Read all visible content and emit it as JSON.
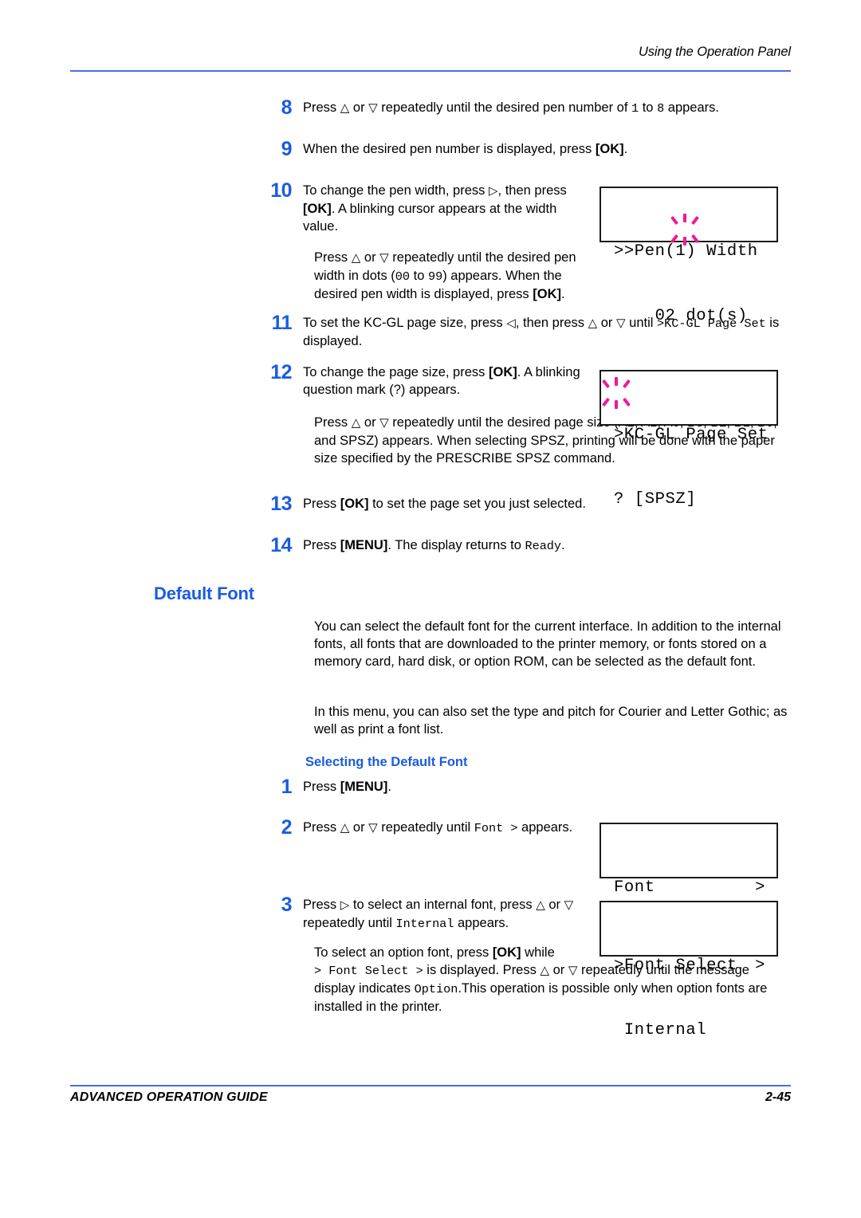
{
  "header": {
    "running_title": "Using the Operation Panel"
  },
  "footer": {
    "guide_title": "ADVANCED OPERATION GUIDE",
    "page_number": "2-45"
  },
  "colors": {
    "accent_blue": "#1a5ce0",
    "rule_blue": "#4a6fe0",
    "blink_magenta": "#f0179c",
    "text_black": "#000000"
  },
  "steps": {
    "s8": {
      "num": "8",
      "text_a": "Press ",
      "up": "△",
      "text_b": " or ",
      "down": "▽",
      "text_c": " repeatedly until the desired pen number of ",
      "lit_a": "1",
      "text_d": " to ",
      "lit_b": "8",
      "text_e": " appears."
    },
    "s9": {
      "num": "9",
      "text_a": "When the desired pen number is displayed, press ",
      "key": "[OK]",
      "text_b": "."
    },
    "s10": {
      "num": "10",
      "p1_a": "To change the pen width, press ",
      "p1_right": "▷",
      "p1_b": ", then press ",
      "p1_key": "[OK]",
      "p1_c": ". A blinking cursor appears at the width value.",
      "p2_a": "Press ",
      "p2_up": "△",
      "p2_b": " or ",
      "p2_down": "▽",
      "p2_c": " repeatedly until the desired pen width in dots (",
      "p2_lit_a": "00",
      "p2_d": " to ",
      "p2_lit_b": "99",
      "p2_e": ") appears. When the desired pen width is displayed, press ",
      "p2_key": "[OK]",
      "p2_f": "."
    },
    "s11": {
      "num": "11",
      "text_a": "To set the KC-GL page size, press ",
      "left": "◁",
      "text_b": ", then press ",
      "up": "△",
      "text_c": " or ",
      "down": "▽",
      "text_d": " until ",
      "lit_a": ">KC-GL Page Set",
      "text_e": " is displayed."
    },
    "s12": {
      "num": "12",
      "p1_a": "To change the page size, press ",
      "p1_key": "[OK]",
      "p1_b": ". A blinking question mark (?) appears.",
      "p2_a": "Press ",
      "p2_up": "△",
      "p2_b": " or ",
      "p2_down": "▽",
      "p2_c": " repeatedly until the desired page size (A2, A1, A0, B3, B2, B1, B0, and SPSZ) appears. When selecting SPSZ, printing will be done with the paper size specified by the PRESCRIBE SPSZ command."
    },
    "s13": {
      "num": "13",
      "text_a": "Press ",
      "key": "[OK]",
      "text_b": " to set the page set you just selected."
    },
    "s14": {
      "num": "14",
      "text_a": "Press ",
      "key": "[MENU]",
      "text_b": ". The display returns to ",
      "lit": "Ready",
      "text_c": "."
    }
  },
  "default_font_section": {
    "heading": "Default Font",
    "para1": "You can select the default font for the current interface. In addition to the internal fonts, all fonts that are downloaded to the printer memory, or fonts stored on a memory card, hard disk, or option ROM, can be selected as the default font.",
    "para2": "In this menu, you can also set the type and pitch for Courier and Letter Gothic; as well as print a font list.",
    "subheading": "Selecting the Default Font",
    "steps": {
      "s1": {
        "num": "1",
        "text_a": "Press ",
        "key": "[MENU]",
        "text_b": "."
      },
      "s2": {
        "num": "2",
        "text_a": "Press ",
        "up": "△",
        "text_b": " or ",
        "down": "▽",
        "text_c": " repeatedly until ",
        "lit": "Font >",
        "text_d": " appears."
      },
      "s3": {
        "num": "3",
        "p1_a": "Press ",
        "p1_right": "▷",
        "p1_b": " to select an internal font, press ",
        "p1_up": "△",
        "p1_c": " or ",
        "p1_down": "▽",
        "p1_d": " repeatedly until ",
        "p1_lit": "Internal",
        "p1_e": " appears.",
        "p2_a": "To select an option font, press ",
        "p2_key": "[OK]",
        "p2_b": " while ",
        "p2_lit_a": "> Font Select >",
        "p2_c": " is displayed. Press ",
        "p2_up": "△",
        "p2_d": " or ",
        "p2_down": "▽",
        "p2_e": " repeatedly until the message display indicates ",
        "p2_lit_b": "Option",
        "p2_f": ".This operation is possible only when option fonts are installed in the printer."
      }
    }
  },
  "lcd_panels": {
    "pen_width": {
      "line1": ">>Pen(1) Width",
      "line2_value": "02",
      "line2_unit": " dot(s)",
      "blink_target": "02"
    },
    "kcgl_page_set": {
      "line1": ">KC-GL Page Set",
      "line2_value": "?",
      "line2_rest": " [SPSZ]",
      "blink_target": "?"
    },
    "font_menu": {
      "line1_left": "Font",
      "line1_right": ">",
      "line2": ""
    },
    "font_select": {
      "line1_left": ">Font Select",
      "line1_right": ">",
      "line2": " Internal"
    }
  }
}
